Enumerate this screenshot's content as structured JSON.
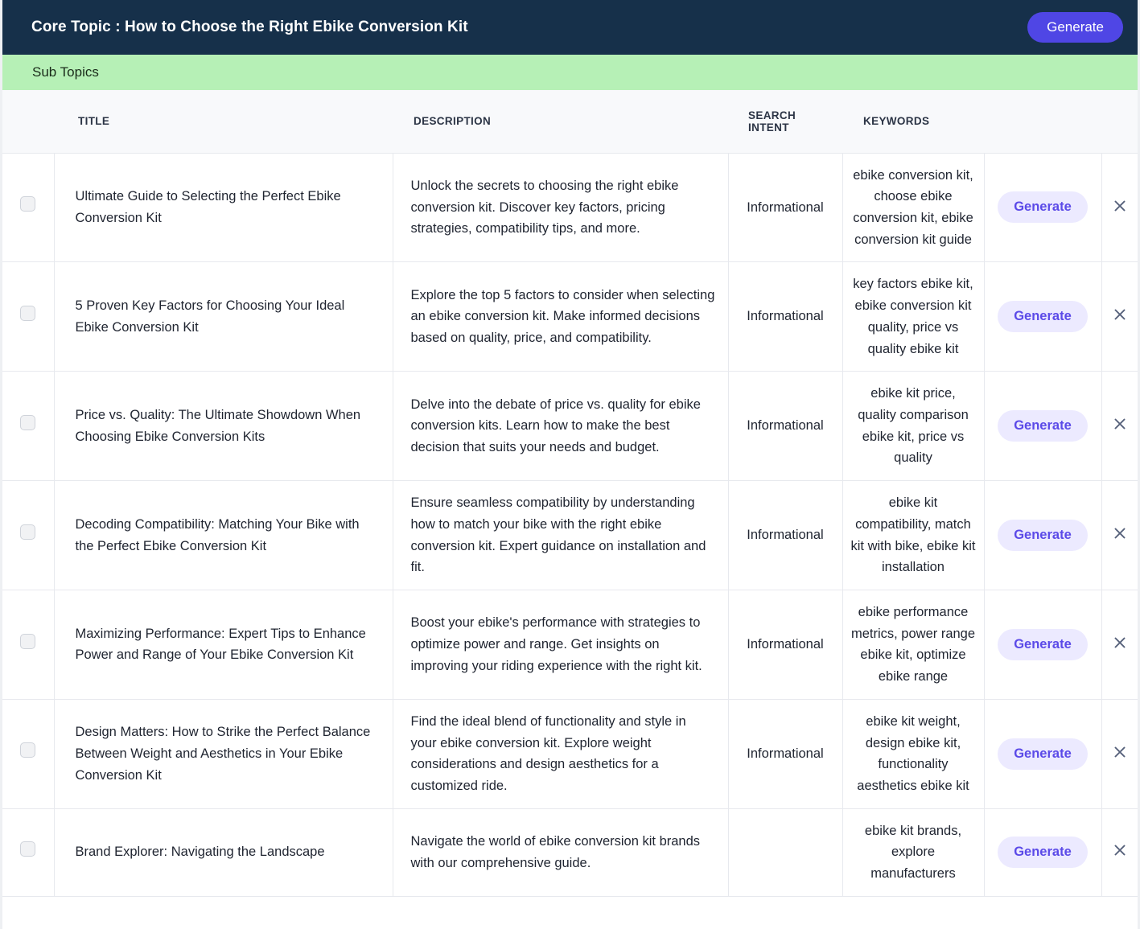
{
  "header": {
    "core_topic_label": "Core Topic : How to Choose the Right Ebike Conversion Kit",
    "generate_label": "Generate",
    "background_color": "#16304a",
    "generate_color": "#4f46e5"
  },
  "subtopics_bar": {
    "label": "Sub Topics",
    "background_color": "#b6f0b6"
  },
  "table": {
    "columns": {
      "title": "TITLE",
      "description": "DESCRIPTION",
      "search_intent": "SEARCH INTENT",
      "keywords": "KEYWORDS"
    },
    "row_action_label": "Generate",
    "delete_icon": "close-icon",
    "checkbox_state": "unchecked",
    "rows": [
      {
        "title": "Ultimate Guide to Selecting the Perfect Ebike Conversion Kit",
        "description": "Unlock the secrets to choosing the right ebike conversion kit. Discover key factors, pricing strategies, compatibility tips, and more.",
        "search_intent": "Informational",
        "keywords": "ebike conversion kit, choose ebike conversion kit, ebike conversion kit guide",
        "generate_label": "Generate"
      },
      {
        "title": "5 Proven Key Factors for Choosing Your Ideal Ebike Conversion Kit",
        "description": "Explore the top 5 factors to consider when selecting an ebike conversion kit. Make informed decisions based on quality, price, and compatibility.",
        "search_intent": "Informational",
        "keywords": "key factors ebike kit, ebike conversion kit quality, price vs quality ebike kit",
        "generate_label": "Generate"
      },
      {
        "title": "Price vs. Quality: The Ultimate Showdown When Choosing Ebike Conversion Kits",
        "description": "Delve into the debate of price vs. quality for ebike conversion kits. Learn how to make the best decision that suits your needs and budget.",
        "search_intent": "Informational",
        "keywords": "ebike kit price, quality comparison ebike kit, price vs quality",
        "generate_label": "Generate"
      },
      {
        "title": "Decoding Compatibility: Matching Your Bike with the Perfect Ebike Conversion Kit",
        "description": "Ensure seamless compatibility by understanding how to match your bike with the right ebike conversion kit. Expert guidance on installation and fit.",
        "search_intent": "Informational",
        "keywords": "ebike kit compatibility, match kit with bike, ebike kit installation",
        "generate_label": "Generate"
      },
      {
        "title": "Maximizing Performance: Expert Tips to Enhance Power and Range of Your Ebike Conversion Kit",
        "description": "Boost your ebike's performance with strategies to optimize power and range. Get insights on improving your riding experience with the right kit.",
        "search_intent": "Informational",
        "keywords": "ebike performance metrics, power range ebike kit, optimize ebike range",
        "generate_label": "Generate"
      },
      {
        "title": "Design Matters: How to Strike the Perfect Balance Between Weight and Aesthetics in Your Ebike Conversion Kit",
        "description": "Find the ideal blend of functionality and style in your ebike conversion kit. Explore weight considerations and design aesthetics for a customized ride.",
        "search_intent": "Informational",
        "keywords": "ebike kit weight, design ebike kit, functionality aesthetics ebike kit",
        "generate_label": "Generate"
      },
      {
        "title": "Brand Explorer: Navigating the Landscape",
        "description": "Navigate the world of ebike conversion kit brands with our comprehensive guide.",
        "search_intent": "",
        "keywords": "ebike kit brands, explore manufacturers",
        "generate_label": "Generate"
      }
    ]
  }
}
